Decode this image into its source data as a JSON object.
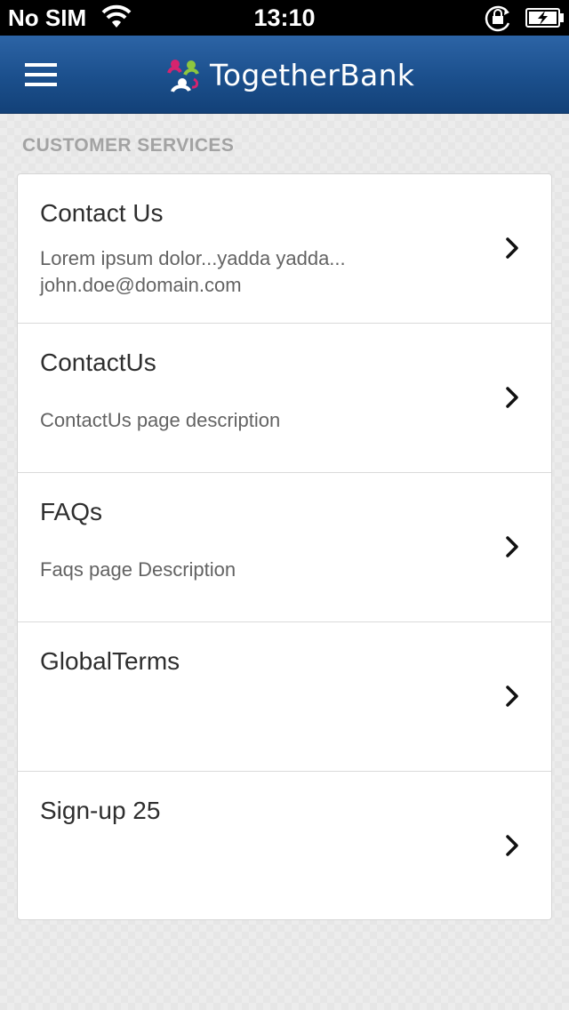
{
  "status_bar": {
    "carrier": "No SIM",
    "time": "13:10",
    "icons": [
      "wifi-icon",
      "orientation-lock-icon",
      "battery-charging-icon"
    ]
  },
  "header": {
    "brand_name": "TogetherBank",
    "menu_icon": "hamburger-menu-icon",
    "logo_colors": [
      "#d6246e",
      "#8dc63f",
      "#2c64a6"
    ],
    "background_color": "#1b4f8c"
  },
  "section": {
    "title": "CUSTOMER SERVICES"
  },
  "items": [
    {
      "title": "Contact Us",
      "description": "Lorem ipsum dolor...yadda yadda...\njohn.doe@domain.com"
    },
    {
      "title": "ContactUs",
      "description": "ContactUs page description"
    },
    {
      "title": "FAQs",
      "description": "Faqs page Description"
    },
    {
      "title": "GlobalTerms",
      "description": ""
    },
    {
      "title": "Sign-up 25",
      "description": ""
    }
  ]
}
